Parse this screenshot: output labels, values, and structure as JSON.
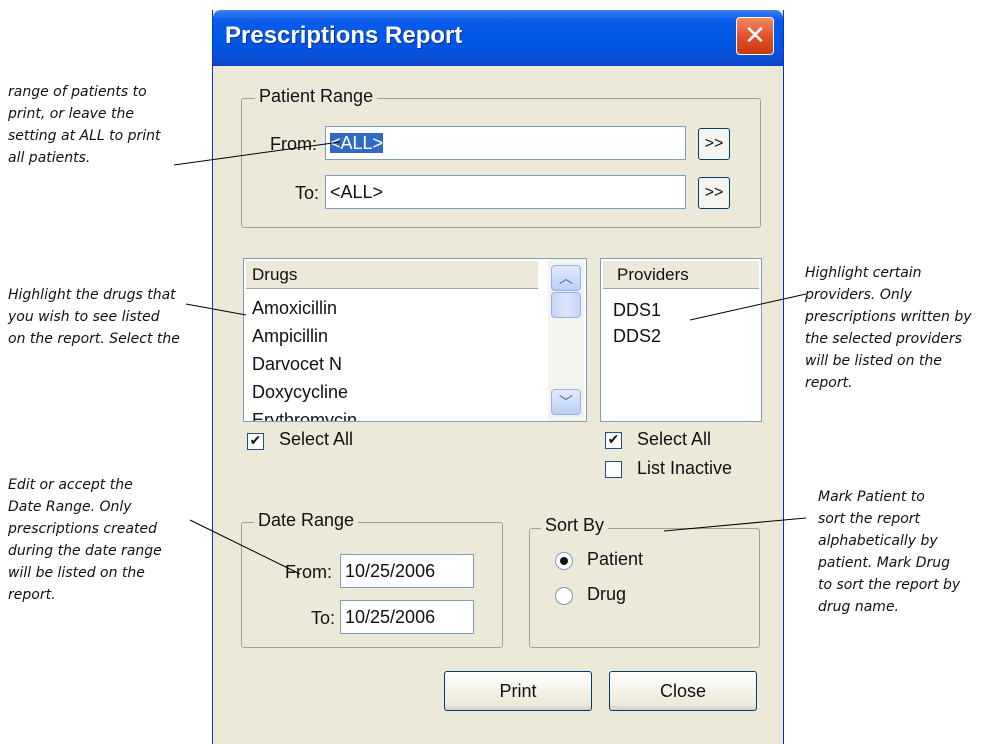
{
  "annotations": {
    "patient_range": [
      "range of patients to",
      "print, or leave the",
      "setting at ALL to print",
      "all patients."
    ],
    "drugs": [
      "Highlight the drugs that",
      "you wish to see listed",
      "on the report. Select the"
    ],
    "providers": [
      "Highlight certain",
      "providers. Only",
      "prescriptions written by",
      "the selected providers",
      "will be listed on the",
      "report."
    ],
    "date_range": [
      "Edit or accept the",
      "Date Range. Only",
      "prescriptions created",
      "during the date range",
      "will be listed on the",
      "report."
    ],
    "sort_by": [
      "Mark Patient to",
      "sort the report",
      "alphabetically by",
      "patient. Mark Drug",
      "to sort the report by",
      "drug name."
    ]
  },
  "window": {
    "title": "Prescriptions Report",
    "close_glyph": "✕"
  },
  "patient_range": {
    "legend": "Patient Range",
    "from_label": "From:",
    "from_value": "<ALL>",
    "to_label": "To:",
    "to_value": "<ALL>",
    "browse_label": ">>"
  },
  "drugs": {
    "header": "Drugs",
    "items": [
      "Amoxicillin",
      "Ampicillin",
      "Darvocet N",
      "Doxycycline",
      "Erythromycin"
    ],
    "select_all_label": "Select All",
    "select_all_checked": true,
    "scroll_up_glyph": "︿",
    "scroll_down_glyph": "﹀"
  },
  "providers": {
    "header": "Providers",
    "items": [
      "DDS1",
      "DDS2"
    ],
    "select_all_label": "Select All",
    "select_all_checked": true,
    "list_inactive_label": "List Inactive",
    "list_inactive_checked": false
  },
  "date_range": {
    "legend": "Date Range",
    "from_label": "From:",
    "from_value": "10/25/2006",
    "to_label": "To:",
    "to_value": "10/25/2006"
  },
  "sort_by": {
    "legend": "Sort By",
    "options": [
      "Patient",
      "Drug"
    ],
    "selected": "Patient"
  },
  "buttons": {
    "print": "Print",
    "close": "Close"
  },
  "check_glyph": "✔"
}
